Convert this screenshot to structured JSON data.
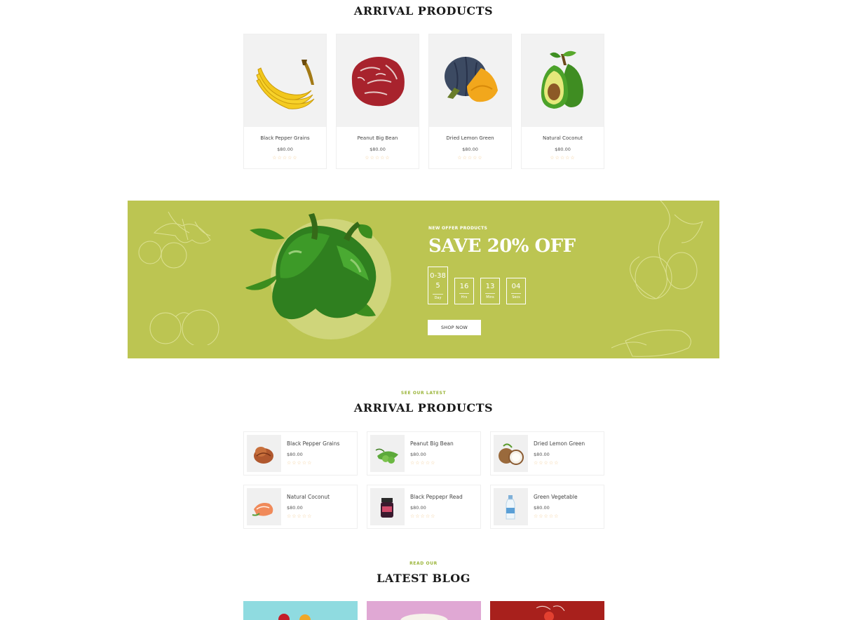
{
  "arrival_top": {
    "title": "ARRIVAL PRODUCTS",
    "products": [
      {
        "name": "Black Pepper Grains",
        "price": "$80.00",
        "rating": 0,
        "image": "bananas"
      },
      {
        "name": "Peanut Big Bean",
        "price": "$80.00",
        "rating": 0,
        "image": "raw-meat"
      },
      {
        "name": "Dried Lemon Green",
        "price": "$80.00",
        "rating": 0,
        "image": "pumpkin"
      },
      {
        "name": "Natural Coconut",
        "price": "$80.00",
        "rating": 0,
        "image": "avocado"
      }
    ]
  },
  "offer_banner": {
    "eyebrow": "NEW OFFER PRODUCTS",
    "title": "SAVE 20% OFF",
    "countdown": [
      {
        "value": "0-385",
        "label": "Day"
      },
      {
        "value": "16",
        "label": "Hrs"
      },
      {
        "value": "13",
        "label": "Mins"
      },
      {
        "value": "04",
        "label": "Secs"
      }
    ],
    "button_label": "SHOP NOW",
    "bg_color": "#bcc552"
  },
  "arrival_list": {
    "eyebrow": "SEE OUR LATEST",
    "title": "ARRIVAL PRODUCTS",
    "products": [
      {
        "name": "Black Pepper Grains",
        "price": "$80.00",
        "rating": 0,
        "image": "nuts"
      },
      {
        "name": "Peanut Big Bean",
        "price": "$80.00",
        "rating": 0,
        "image": "green-peas"
      },
      {
        "name": "Dried Lemon Green",
        "price": "$80.00",
        "rating": 0,
        "image": "coconut"
      },
      {
        "name": "Natural Coconut",
        "price": "$80.00",
        "rating": 0,
        "image": "shrimp"
      },
      {
        "name": "Black Peppepr Read",
        "price": "$80.00",
        "rating": 0,
        "image": "jam-jar"
      },
      {
        "name": "Green Vegetable",
        "price": "$80.00",
        "rating": 0,
        "image": "milk-bottle"
      }
    ]
  },
  "blog": {
    "eyebrow": "READ OUR",
    "title": "LATEST BLOG",
    "posts": [
      {
        "image": "fruits-cyan"
      },
      {
        "image": "cauliflower-pink"
      },
      {
        "image": "tomato-red"
      }
    ]
  },
  "colors": {
    "accent": "#9bb53a",
    "star": "#f2c98f",
    "banner": "#bcc552"
  }
}
